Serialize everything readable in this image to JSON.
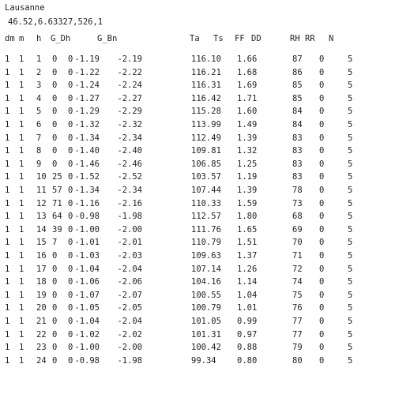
{
  "location_name": "Lausanne",
  "location_info": "46.52,6.63327,526,1",
  "columns": [
    "dm",
    "m",
    "h",
    "G_Dh",
    "G_Bn",
    "Ta",
    "Ts",
    "FF",
    "DD",
    "RH",
    "RR",
    "N"
  ],
  "rows": [
    [
      "1",
      "1",
      "1",
      "0",
      "0",
      "-1.19",
      "-2.19",
      "116.10",
      "1.66",
      "87",
      "0",
      "5"
    ],
    [
      "1",
      "1",
      "2",
      "0",
      "0",
      "-1.22",
      "-2.22",
      "116.21",
      "1.68",
      "86",
      "0",
      "5"
    ],
    [
      "1",
      "1",
      "3",
      "0",
      "0",
      "-1.24",
      "-2.24",
      "116.31",
      "1.69",
      "85",
      "0",
      "5"
    ],
    [
      "1",
      "1",
      "4",
      "0",
      "0",
      "-1.27",
      "-2.27",
      "116.42",
      "1.71",
      "85",
      "0",
      "5"
    ],
    [
      "1",
      "1",
      "5",
      "0",
      "0",
      "-1.29",
      "-2.29",
      "115.28",
      "1.60",
      "84",
      "0",
      "5"
    ],
    [
      "1",
      "1",
      "6",
      "0",
      "0",
      "-1.32",
      "-2.32",
      "113.99",
      "1.49",
      "84",
      "0",
      "5"
    ],
    [
      "1",
      "1",
      "7",
      "0",
      "0",
      "-1.34",
      "-2.34",
      "112.49",
      "1.39",
      "83",
      "0",
      "5"
    ],
    [
      "1",
      "1",
      "8",
      "0",
      "0",
      "-1.40",
      "-2.40",
      "109.81",
      "1.32",
      "83",
      "0",
      "5"
    ],
    [
      "1",
      "1",
      "9",
      "0",
      "0",
      "-1.46",
      "-2.46",
      "106.85",
      "1.25",
      "83",
      "0",
      "5"
    ],
    [
      "1",
      "1",
      "10",
      "25",
      "0",
      "-1.52",
      "-2.52",
      "103.57",
      "1.19",
      "83",
      "0",
      "5"
    ],
    [
      "1",
      "1",
      "11",
      "57",
      "0",
      "-1.34",
      "-2.34",
      "107.44",
      "1.39",
      "78",
      "0",
      "5"
    ],
    [
      "1",
      "1",
      "12",
      "71",
      "0",
      "-1.16",
      "-2.16",
      "110.33",
      "1.59",
      "73",
      "0",
      "5"
    ],
    [
      "1",
      "1",
      "13",
      "64",
      "0",
      "-0.98",
      "-1.98",
      "112.57",
      "1.80",
      "68",
      "0",
      "5"
    ],
    [
      "1",
      "1",
      "14",
      "39",
      "0",
      "-1.00",
      "-2.00",
      "111.76",
      "1.65",
      "69",
      "0",
      "5"
    ],
    [
      "1",
      "1",
      "15",
      "7",
      "0",
      "-1.01",
      "-2.01",
      "110.79",
      "1.51",
      "70",
      "0",
      "5"
    ],
    [
      "1",
      "1",
      "16",
      "0",
      "0",
      "-1.03",
      "-2.03",
      "109.63",
      "1.37",
      "71",
      "0",
      "5"
    ],
    [
      "1",
      "1",
      "17",
      "0",
      "0",
      "-1.04",
      "-2.04",
      "107.14",
      "1.26",
      "72",
      "0",
      "5"
    ],
    [
      "1",
      "1",
      "18",
      "0",
      "0",
      "-1.06",
      "-2.06",
      "104.16",
      "1.14",
      "74",
      "0",
      "5"
    ],
    [
      "1",
      "1",
      "19",
      "0",
      "0",
      "-1.07",
      "-2.07",
      "100.55",
      "1.04",
      "75",
      "0",
      "5"
    ],
    [
      "1",
      "1",
      "20",
      "0",
      "0",
      "-1.05",
      "-2.05",
      "100.79",
      "1.01",
      "76",
      "0",
      "5"
    ],
    [
      "1",
      "1",
      "21",
      "0",
      "0",
      "-1.04",
      "-2.04",
      "101.05",
      "0.99",
      "77",
      "0",
      "5"
    ],
    [
      "1",
      "1",
      "22",
      "0",
      "0",
      "-1.02",
      "-2.02",
      "101.31",
      "0.97",
      "77",
      "0",
      "5"
    ],
    [
      "1",
      "1",
      "23",
      "0",
      "0",
      "-1.00",
      "-2.00",
      "100.42",
      "0.88",
      "79",
      "0",
      "5"
    ],
    [
      "1",
      "1",
      "24",
      "0",
      "0",
      "-0.98",
      "-1.98",
      "99.34",
      "0.80",
      "80",
      "0",
      "5"
    ]
  ]
}
